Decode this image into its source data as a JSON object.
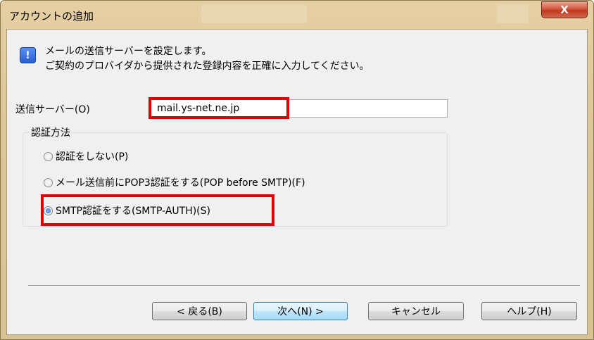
{
  "window": {
    "title": "アカウントの追加",
    "close_label": "X"
  },
  "intro": {
    "icon": "info-icon",
    "line1": "メールの送信サーバーを設定します。",
    "line2": "ご契約のプロバイダから提供された登録内容を正確に入力してください。"
  },
  "server": {
    "label": "送信サーバー(O)",
    "value": "mail.ys-net.ne.jp"
  },
  "auth": {
    "group_title": "認証方法",
    "options": [
      {
        "label": "認証をしない(P)",
        "selected": false
      },
      {
        "label": "メール送信前にPOP3認証をする(POP before SMTP)(F)",
        "selected": false
      },
      {
        "label": "SMTP認証をする(SMTP-AUTH)(S)",
        "selected": true
      }
    ]
  },
  "buttons": {
    "back": "< 戻る(B)",
    "next": "次へ(N) >",
    "cancel": "キャンセル",
    "help": "ヘルプ(H)"
  },
  "colors": {
    "highlight": "#e00000",
    "title_bar": "#dcc598",
    "close_button": "#c0361b"
  }
}
